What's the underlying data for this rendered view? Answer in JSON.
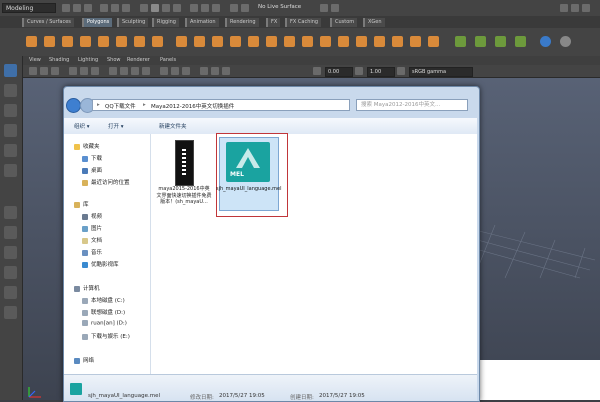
{
  "maya": {
    "mode_menu": "Modeling",
    "no_live_surface": "No Live Surface",
    "shelf_tabs": [
      {
        "label": "Curves / Surfaces",
        "active": false
      },
      {
        "label": "Polygons",
        "active": true
      },
      {
        "label": "Sculpting",
        "active": false
      },
      {
        "label": "Rigging",
        "active": false
      },
      {
        "label": "Animation",
        "active": false
      },
      {
        "label": "Rendering",
        "active": false
      },
      {
        "label": "FX",
        "active": false
      },
      {
        "label": "FX Caching",
        "active": false
      },
      {
        "label": "Custom",
        "active": false
      },
      {
        "label": "XGen",
        "active": false
      }
    ],
    "viewport_menu": [
      "View",
      "Shading",
      "Lighting",
      "Show",
      "Renderer",
      "Panels"
    ],
    "field_a": "0.00",
    "field_b": "1.00",
    "colorspace": "sRGB gamma"
  },
  "explorer": {
    "breadcrumb": [
      "QQ下载文件",
      "Maya2012-2016中英文切换插件"
    ],
    "search_placeholder": "搜索 Maya2012-2016中英文...",
    "cmd_organize": "组织 ▾",
    "cmd_open": "打开 ▾",
    "cmd_new_folder": "新建文件夹",
    "nav": {
      "favorites_header": "收藏夹",
      "favorites": [
        "下载",
        "桌面",
        "最近访问的位置"
      ],
      "library_header": "库",
      "libraries": [
        "视频",
        "图片",
        "文档",
        "音乐",
        "优酷影视库"
      ],
      "computer_header": "计算机",
      "drives": [
        "本地磁盘 (C:)",
        "联想磁盘 (D:)",
        "ruan[an] (D:)",
        "下载与娱乐 (E:)"
      ],
      "network": "网络"
    },
    "files": [
      {
        "name": "maya2015-2016中英文界面快速切换插件免费版本！(sh_mayaU...",
        "icon": "exe-icon"
      },
      {
        "name": "sjh_mayaUI_language.mel",
        "icon": "mel-file-icon",
        "icon_text": "MEL",
        "selected": true
      }
    ],
    "details": {
      "filename": "sjh_mayaUI_language.mel",
      "modified_label": "修改日期:",
      "modified_value": "2017/5/27 19:05",
      "created_label": "创建日期:",
      "created_value": "2017/5/27 19:05"
    }
  }
}
